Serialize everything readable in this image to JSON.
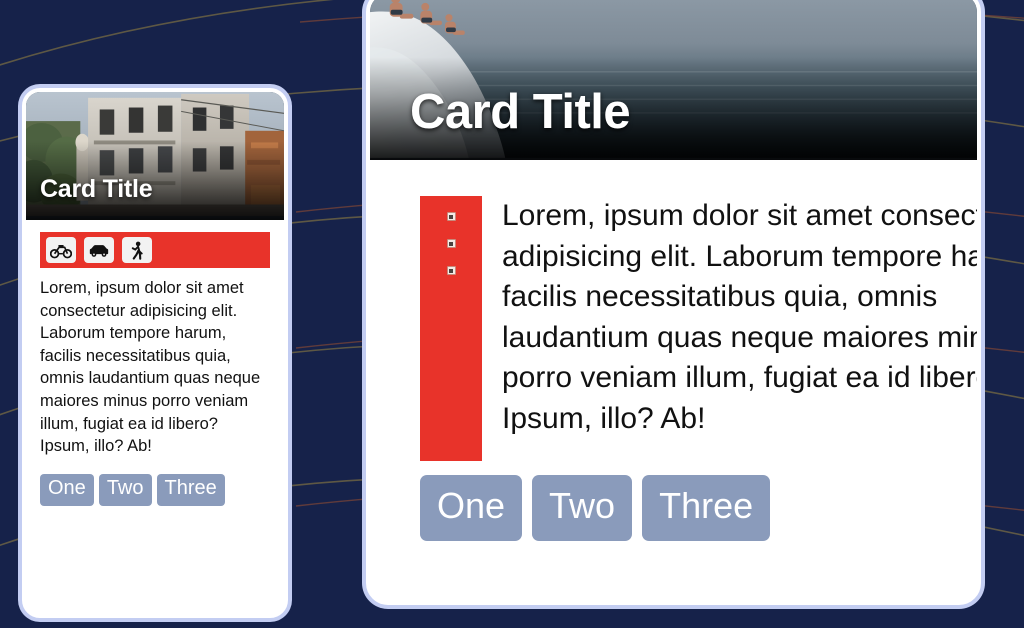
{
  "background": {
    "color": "#16224a",
    "line_color": "#6b6244",
    "name": "dark-navy-with-curves"
  },
  "theme": {
    "card_surface": "#ffffff",
    "card_border": "#ffffff",
    "card_outline": "#c3cdf2",
    "accent_red": "#e8332a",
    "button_bg": "#8a9bbb",
    "button_text": "#ffffff",
    "body_text": "#111111"
  },
  "cards": [
    {
      "id": "mobile-card",
      "title": "Card Title",
      "media": {
        "name": "street-buildings-photo",
        "alt": "Narrow European street with old apartment buildings and greenery"
      },
      "icons": [
        {
          "name": "bicycle-icon",
          "label": "Bicycle"
        },
        {
          "name": "car-icon",
          "label": "Car"
        },
        {
          "name": "walking-person-icon",
          "label": "Walk"
        }
      ],
      "text": "Lorem, ipsum dolor sit amet consectetur adipisicing elit. Laborum tempore harum, facilis necessitatibus quia, omnis laudantium quas neque maiores minus porro veniam illum, fugiat ea id libero? Ipsum, illo? Ab!",
      "buttons": [
        "One",
        "Two",
        "Three"
      ]
    },
    {
      "id": "desktop-card",
      "title": "Card Title",
      "media": {
        "name": "seaside-cliff-photo",
        "alt": "People sitting on a white rock cliff above a calm grey-blue sea"
      },
      "icons": [
        {
          "name": "broken-image-placeholder-icon",
          "label": ""
        },
        {
          "name": "broken-image-placeholder-icon",
          "label": ""
        },
        {
          "name": "broken-image-placeholder-icon",
          "label": ""
        }
      ],
      "text": "Lorem, ipsum dolor sit amet consectetur adipisicing elit. Laborum tempore harum, facilis necessitatibus quia, omnis laudantium quas neque maiores minus porro veniam illum, fugiat ea id libero? Ipsum, illo? Ab!",
      "buttons": [
        "One",
        "Two",
        "Three"
      ]
    }
  ]
}
